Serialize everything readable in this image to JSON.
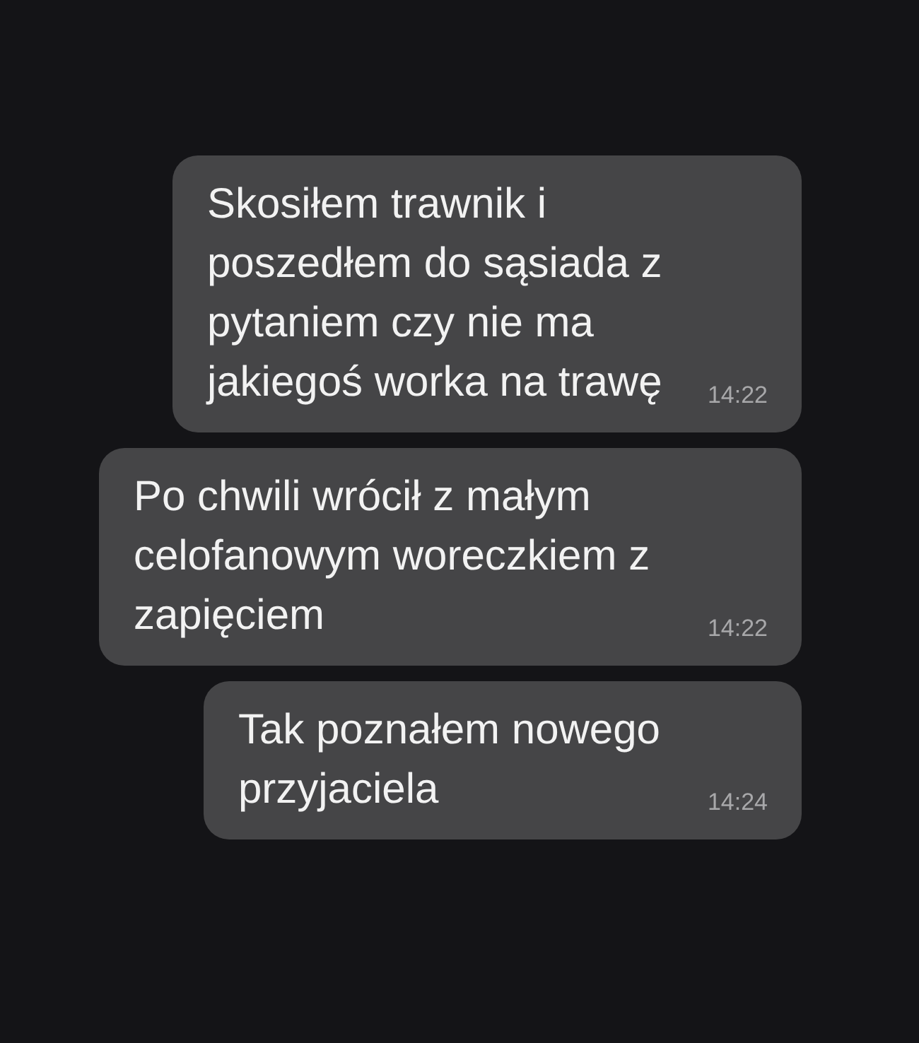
{
  "messages": [
    {
      "text": "Skosiłem trawnik i poszedłem do sąsiada z pytaniem czy nie ma jakiegoś worka na trawę",
      "time": "14:22"
    },
    {
      "text": "Po chwili wrócił z małym celofanowym woreczkiem z zapięciem",
      "time": "14:22"
    },
    {
      "text": "Tak poznałem nowego przyjaciela",
      "time": "14:24"
    }
  ]
}
